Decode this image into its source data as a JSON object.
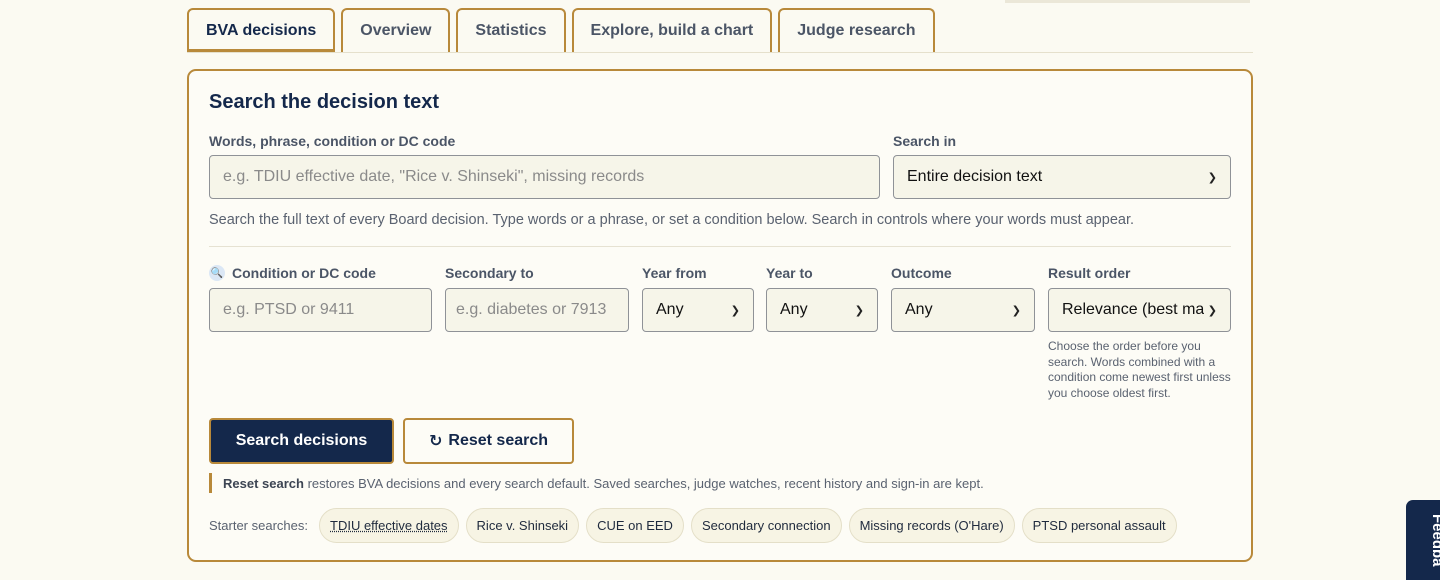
{
  "tabs": [
    {
      "label": "BVA decisions",
      "active": true
    },
    {
      "label": "Overview"
    },
    {
      "label": "Statistics"
    },
    {
      "label": "Explore, build a chart"
    },
    {
      "label": "Judge research"
    }
  ],
  "panel": {
    "title": "Search the decision text",
    "query": {
      "label": "Words, phrase, condition or DC code",
      "placeholder": "e.g. TDIU effective date, \"Rice v. Shinseki\", missing records"
    },
    "search_in": {
      "label": "Search in",
      "value": "Entire decision text"
    },
    "help_text": "Search the full text of every Board decision. Type words or a phrase, or set a condition below. Search in controls where your words must appear.",
    "condition": {
      "label": "Condition or DC code",
      "placeholder": "e.g. PTSD or 9411",
      "icon": "magnifier-icon"
    },
    "secondary": {
      "label": "Secondary to",
      "placeholder": "e.g. diabetes or 7913"
    },
    "year_from": {
      "label": "Year from",
      "value": "Any"
    },
    "year_to": {
      "label": "Year to",
      "value": "Any"
    },
    "outcome": {
      "label": "Outcome",
      "value": "Any"
    },
    "result_order": {
      "label": "Result order",
      "value": "Relevance (best matc",
      "note": "Choose the order before you search. Words combined with a condition come newest first unless you choose oldest first."
    },
    "search_button": "Search decisions",
    "reset_button": {
      "icon": "↻",
      "label": "Reset search"
    },
    "reset_note": {
      "bold": "Reset search",
      "text": " restores BVA decisions and every search default. Saved searches, judge watches, recent history and sign-in are kept."
    },
    "starter": {
      "label": "Starter searches:",
      "chips": [
        "TDIU effective dates",
        "Rice v. Shinseki",
        "CUE on EED",
        "Secondary connection",
        "Missing records (O'Hare)",
        "PTSD personal assault"
      ]
    }
  },
  "feedback_label": "Feedba",
  "colors": {
    "navy": "#14284b",
    "gold": "#b8893a",
    "background": "#fbfaf2"
  }
}
